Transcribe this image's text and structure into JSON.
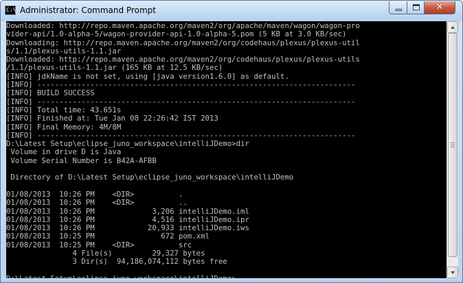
{
  "window": {
    "title": "Administrator: Command Prompt",
    "icon": "cmd-icon",
    "icon_glyph": "C:\\",
    "controls": {
      "minimize": "minimize-icon",
      "maximize": "maximize-icon",
      "close": "close-icon",
      "close_glyph": "✕"
    },
    "colors": {
      "console_bg": "#000000",
      "console_text": "#c0c0c0",
      "close_button": "#c74a32",
      "frame": "#c3dbf2"
    }
  },
  "console": {
    "lines": [
      "Downloaded: http://repo.maven.apache.org/maven2/org/apache/maven/wagon/wagon-pro",
      "vider-api/1.0-alpha-5/wagon-provider-api-1.0-alpha-5.pom (5 KB at 3.0 KB/sec)",
      "Downloading: http://repo.maven.apache.org/maven2/org/codehaus/plexus/plexus-util",
      "s/1.1/plexus-utils-1.1.jar",
      "Downloaded: http://repo.maven.apache.org/maven2/org/codehaus/plexus/plexus-utils",
      "/1.1/plexus-utils-1.1.jar (165 KB at 12.5 KB/sec)",
      "[INFO] jdkName is not set, using [java version1.6.0] as default.",
      "[INFO] ------------------------------------------------------------------------",
      "[INFO] BUILD SUCCESS",
      "[INFO] ------------------------------------------------------------------------",
      "[INFO] Total time: 43.651s",
      "[INFO] Finished at: Tue Jan 08 22:26:42 IST 2013",
      "[INFO] Final Memory: 4M/8M",
      "[INFO] ------------------------------------------------------------------------",
      "D:\\Latest Setup\\eclipse_juno_workspace\\intelliJDemo>dir",
      " Volume in drive D is Java",
      " Volume Serial Number is B42A-AFBB",
      "",
      " Directory of D:\\Latest Setup\\eclipse_juno_workspace\\intelliJDemo",
      "",
      "01/08/2013  10:26 PM    <DIR>          .",
      "01/08/2013  10:26 PM    <DIR>          ..",
      "01/08/2013  10:26 PM             3,206 intelliJDemo.iml",
      "01/08/2013  10:26 PM             4,516 intelliJDemo.ipr",
      "01/08/2013  10:26 PM            20,933 intelliJDemo.iws",
      "01/08/2013  10:25 PM               672 pom.xml",
      "01/08/2013  10:25 PM    <DIR>          src",
      "               4 File(s)         29,327 bytes",
      "               3 Dir(s)  94,186,074,112 bytes free",
      "",
      "D:\\Latest Setup\\eclipse_juno_workspace\\intelliJDemo>"
    ]
  },
  "scrollbar": {
    "position_fraction": 0.97
  }
}
